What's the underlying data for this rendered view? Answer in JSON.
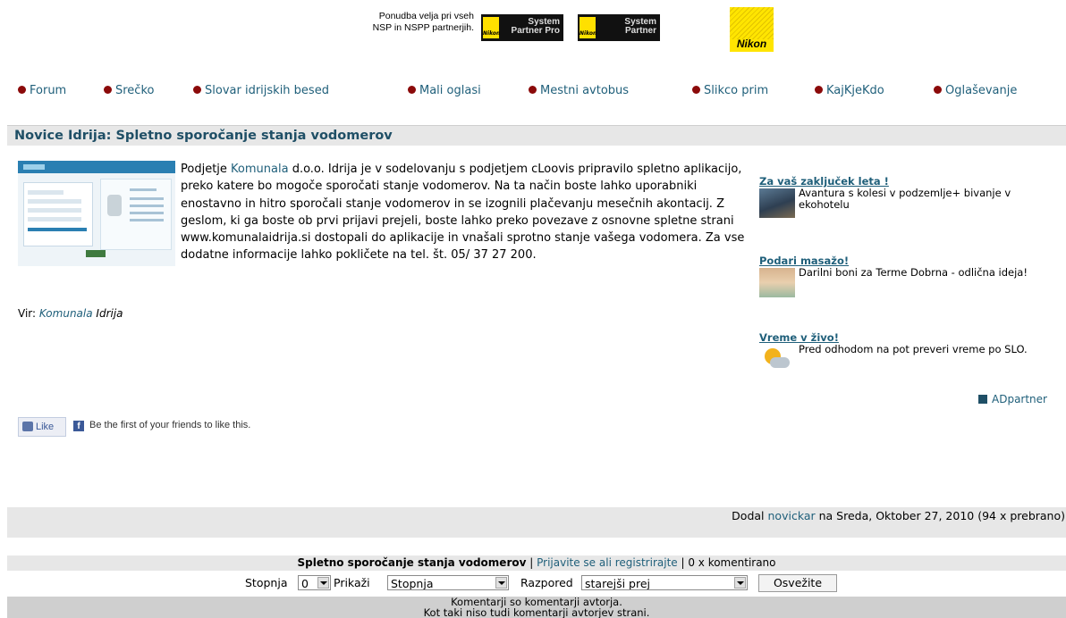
{
  "banner": {
    "promo_line1": "Ponudba velja pri vseh",
    "promo_line2": "NSP in NSPP partnerjih.",
    "badge1_line1": "System",
    "badge1_line2": "Partner Pro",
    "badge2_line1": "System",
    "badge2_line2": "Partner",
    "badge_mark": "Nikon",
    "logo_text": "Nikon"
  },
  "nav": {
    "items": [
      {
        "label": "Forum"
      },
      {
        "label": "Srečko"
      },
      {
        "label": "Slovar idrijskih besed"
      },
      {
        "label": "Mali oglasi"
      },
      {
        "label": "Mestni avtobus"
      },
      {
        "label": "Slikco prim"
      },
      {
        "label": "KajKjeKdo"
      },
      {
        "label": "Oglaševanje"
      }
    ],
    "dot_color": "#8b0a0a"
  },
  "article": {
    "title": "Novice Idrija: Spletno sporočanje stanja vodomerov",
    "body_prefix": "Podjetje ",
    "body_link": "Komunala",
    "body_rest": " d.o.o. Idrija je v sodelovanju s podjetjem cLoovis pripravilo spletno aplikacijo, preko katere bo mogoče sporočati stanje vodomerov. Na ta način boste lahko uporabniki enostavno in hitro sporočali stanje vodomerov in se izognili plačevanju mesečnih akontacij. Z geslom, ki ga boste ob prvi prijavi prejeli, boste lahko preko povezave z osnovne spletne strani www.komunalaidrija.si dostopali do aplikacije in vnašali sprotno stanje vašega vodomera. Za vse dodatne informacije lahko pokličete na tel. št. 05/ 37 27 200.",
    "source_label": "Vir: ",
    "source_link": "Komunala",
    "source_rest": " Idrija",
    "meta_prefix": "Dodal ",
    "meta_author": "novickar",
    "meta_rest": " na Sreda, Oktober 27, 2010 (94 x prebrano)"
  },
  "ads": [
    {
      "title": "Za vaš zaključek leta !",
      "desc": "Avantura s kolesi v podzemlje+ bivanje v ekohotelu"
    },
    {
      "title": "Podari masažo!",
      "desc": "Darilni boni za Terme Dobrna - odlična ideja!"
    },
    {
      "title": "Vreme v živo!",
      "desc": "Pred odhodom na pot preveri vreme po SLO."
    }
  ],
  "adpartner_label": "ADpartner",
  "social": {
    "like_label": "Like",
    "fb_letter": "f",
    "text": "Be the first of your friends to like this."
  },
  "comments": {
    "heading": "Spletno sporočanje stanja vodomerov",
    "sep": " | ",
    "login_link": "Prijavite se ali registrirajte",
    "count_text": " | 0 x komentirano",
    "stopnja_label": "Stopnja",
    "stopnja_value": "0",
    "prikazi_label": "Prikaži",
    "prikazi_value": "Stopnja",
    "razpored_label": "Razpored",
    "razpored_value": "starejši prej",
    "refresh_label": "Osvežite",
    "note_line1": "Komentarji so komentarji avtorja.",
    "note_line2": "Kot taki niso tudi komentarji avtorjev strani."
  }
}
